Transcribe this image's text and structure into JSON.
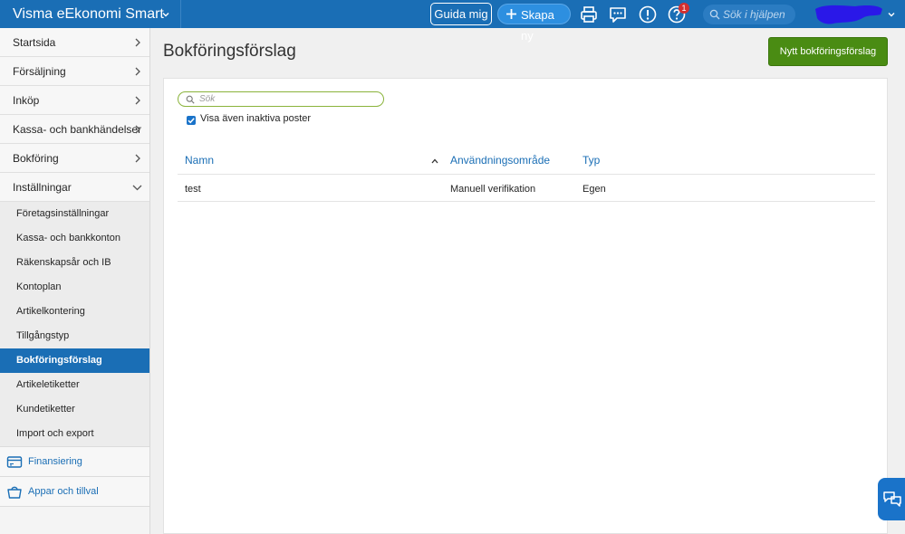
{
  "topbar": {
    "brand": "Visma eEkonomi Smart",
    "guide_label": "Guida mig",
    "create_label": "Skapa ny",
    "notification_count": "1",
    "help_search_placeholder": "Sök i hjälpen",
    "icons": [
      "print-icon",
      "chat-bubble-icon",
      "alert-icon",
      "help-icon"
    ]
  },
  "sidebar": {
    "items": [
      {
        "label": "Startsida"
      },
      {
        "label": "Försäljning"
      },
      {
        "label": "Inköp"
      },
      {
        "label": "Kassa- och bankhändelser"
      },
      {
        "label": "Bokföring"
      },
      {
        "label": "Inställningar"
      }
    ],
    "subitems": [
      {
        "label": "Företagsinställningar"
      },
      {
        "label": "Kassa- och bankkonton"
      },
      {
        "label": "Räkenskapsår och IB"
      },
      {
        "label": "Kontoplan"
      },
      {
        "label": "Artikelkontering"
      },
      {
        "label": "Tillgångstyp"
      },
      {
        "label": "Bokföringsförslag"
      },
      {
        "label": "Artikeletiketter"
      },
      {
        "label": "Kundetiketter"
      },
      {
        "label": "Import och export"
      }
    ],
    "extras": [
      {
        "label": "Finansiering"
      },
      {
        "label": "Appar och tillval"
      }
    ]
  },
  "main": {
    "title": "Bokföringsförslag",
    "new_button_label": "Nytt bokföringsförslag",
    "search_placeholder": "Sök",
    "show_inactive_label": "Visa även inaktiva poster",
    "show_inactive_checked": true,
    "table": {
      "columns": [
        "Namn",
        "Användningsområde",
        "Typ"
      ],
      "rows": [
        {
          "name": "test",
          "usage": "Manuell verifikation",
          "type": "Egen"
        }
      ]
    }
  },
  "colors": {
    "topbar": "#1a6eb5",
    "accent": "#1a6eb5",
    "primary_button": "#4a8c13",
    "search_border": "#8ab33b"
  }
}
